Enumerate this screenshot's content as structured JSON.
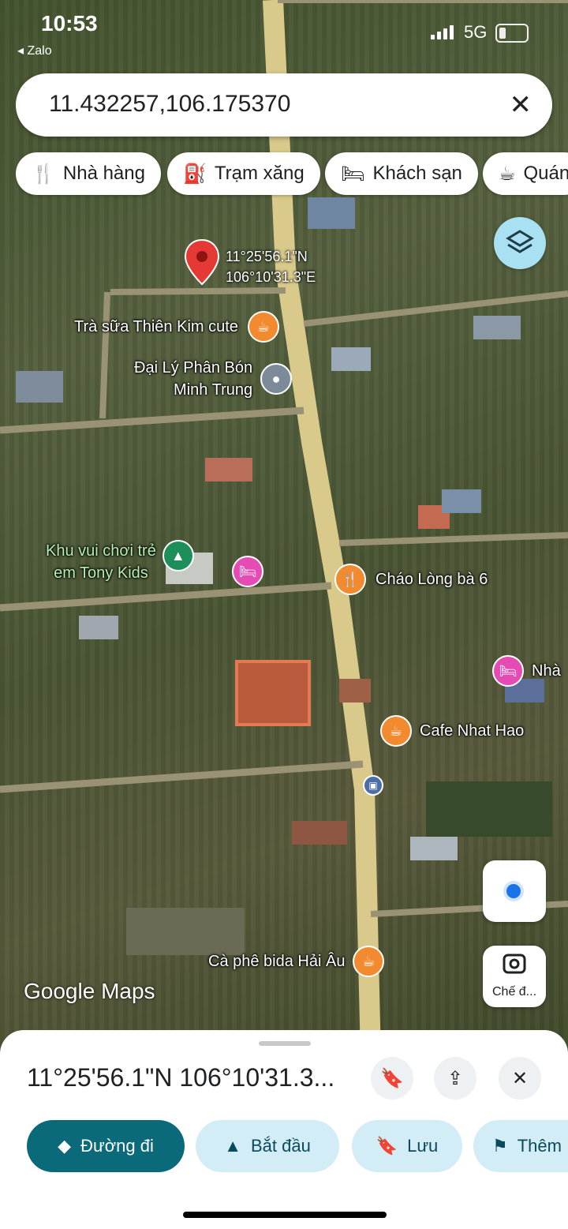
{
  "status_bar": {
    "time": "10:53",
    "back_app": "◂ Zalo",
    "network": "5G"
  },
  "search": {
    "value": "11.432257,106.175370",
    "clear_icon": "close-icon"
  },
  "chips": [
    {
      "label": "Nhà hàng",
      "icon": "restaurant-icon"
    },
    {
      "label": "Trạm xăng",
      "icon": "gas-station-icon"
    },
    {
      "label": "Khách sạn",
      "icon": "hotel-icon"
    },
    {
      "label": "Quán",
      "icon": "cafe-icon"
    }
  ],
  "map": {
    "pin_coords_line1": "11°25'56.1\"N",
    "pin_coords_line2": "106°10'31.3\"E",
    "pois": [
      {
        "label": "Trà sữa Thiên Kim cute",
        "type": "cafe",
        "color": "#f28b30"
      },
      {
        "label": "Đại Lý Phân Bón",
        "label2": "Minh Trung",
        "type": "place",
        "color": "#7c8a99"
      },
      {
        "label": "Khu vui chơi trẻ",
        "label2": "em Tony Kids",
        "type": "park",
        "color": "#1e8e5a"
      },
      {
        "label": "",
        "type": "hotel",
        "color": "#e64ab3"
      },
      {
        "label": "Cháo Lòng bà 6",
        "type": "restaurant",
        "color": "#f28b30"
      },
      {
        "label": "Nhà",
        "type": "hotel",
        "color": "#e64ab3"
      },
      {
        "label": "Cafe Nhat Hao",
        "type": "cafe",
        "color": "#f28b30"
      },
      {
        "label": "Cà phê bida Hải Âu",
        "type": "cafe",
        "color": "#f28b30"
      }
    ],
    "attribution": "Google Maps",
    "lens_label": "Chế đ..."
  },
  "sheet": {
    "title": "11°25'56.1\"N 106°10'31.3...",
    "actions": [
      {
        "label": "Đường đi",
        "icon": "directions-icon"
      },
      {
        "label": "Bắt đầu",
        "icon": "navigation-arrow-icon"
      },
      {
        "label": "Lưu",
        "icon": "bookmark-icon"
      },
      {
        "label": "Thêm",
        "icon": "flag-icon"
      }
    ]
  },
  "colors": {
    "primary_action": "#0b6a7a",
    "secondary_action": "#d3edf7",
    "pin": "#e53935",
    "location": "#1a73e8"
  }
}
